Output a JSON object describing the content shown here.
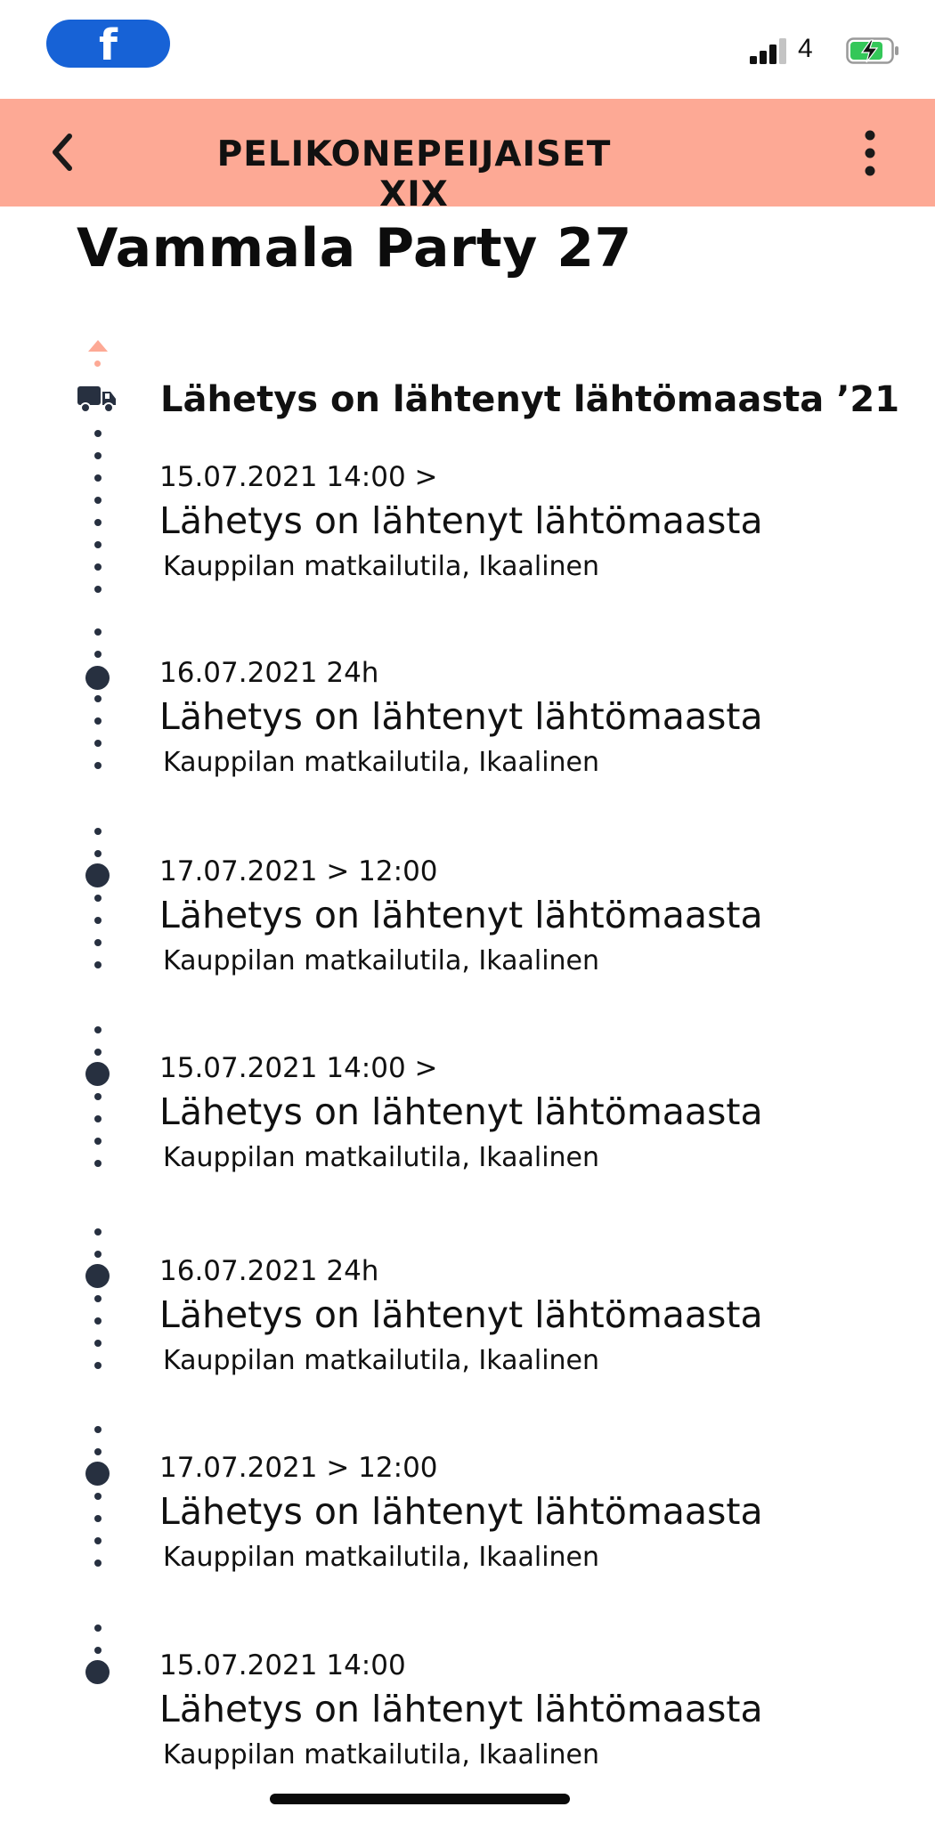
{
  "status_bar": {
    "app_badge": "f",
    "network_label": "4",
    "battery_color": "#34c759"
  },
  "header": {
    "title": "PELIKONEPEIJAISET XIX",
    "background_color": "#fda995"
  },
  "page_title": "Vammala Party 27",
  "shipment_heading": "Lähetys on lähtenyt lähtömaasta ’21",
  "events": [
    {
      "time": "15.07.2021 14:00 >",
      "status": "Lähetys on lähtenyt lähtömaasta",
      "place": "Kauppilan matkailutila, Ikaalinen"
    },
    {
      "time": "16.07.2021 24h",
      "status": "Lähetys on lähtenyt lähtömaasta",
      "place": "Kauppilan matkailutila, Ikaalinen"
    },
    {
      "time": "17.07.2021 > 12:00",
      "status": "Lähetys on lähtenyt lähtömaasta",
      "place": "Kauppilan matkailutila, Ikaalinen"
    },
    {
      "time": "15.07.2021 14:00 >",
      "status": "Lähetys on lähtenyt lähtömaasta",
      "place": "Kauppilan matkailutila, Ikaalinen"
    },
    {
      "time": "16.07.2021 24h",
      "status": "Lähetys on lähtenyt lähtömaasta",
      "place": "Kauppilan matkailutila, Ikaalinen"
    },
    {
      "time": "17.07.2021 > 12:00",
      "status": "Lähetys on lähtenyt lähtömaasta",
      "place": "Kauppilan matkailutila, Ikaalinen"
    },
    {
      "time": "15.07.2021 14:00",
      "status": "Lähetys on lähtenyt lähtömaasta",
      "place": "Kauppilan matkailutila, Ikaalinen"
    }
  ],
  "icons": {
    "app": "facebook-icon",
    "back": "chevron-left-icon",
    "more": "more-vertical-icon",
    "head_node": "truck-icon",
    "top_marker": "caret-up-icon"
  }
}
